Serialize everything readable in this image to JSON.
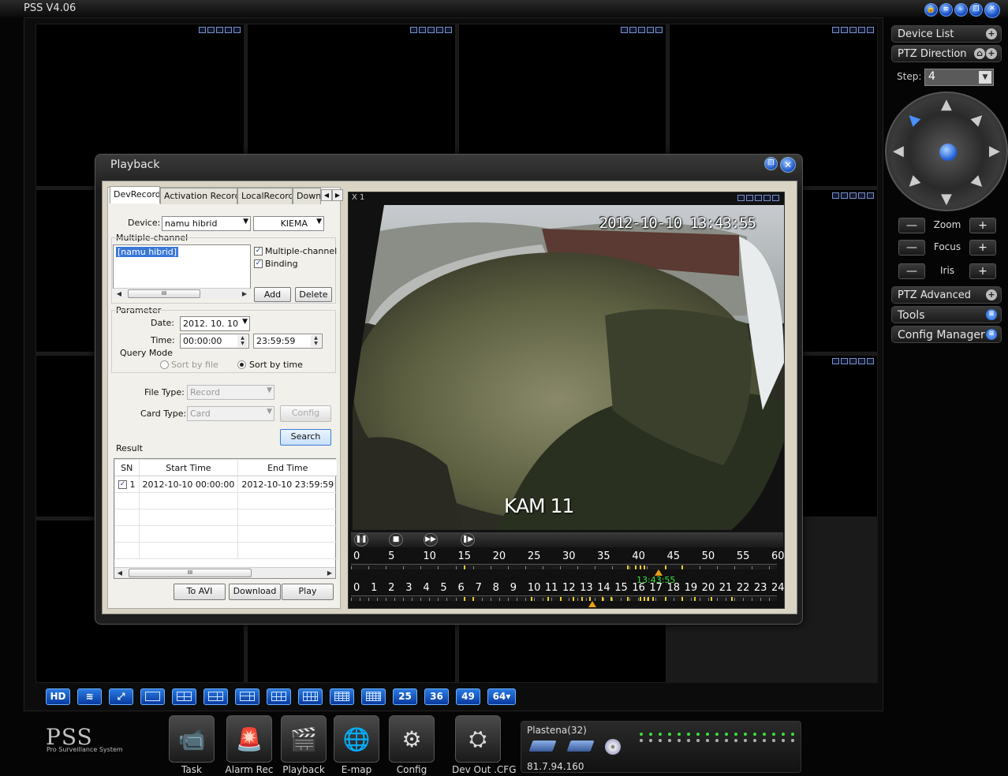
{
  "app": {
    "title": "PSS  V4.06",
    "window_buttons": [
      "lock-icon",
      "list-icon",
      "minimize-icon",
      "restore-icon",
      "close-icon"
    ]
  },
  "right_panel": {
    "device_list": "Device List",
    "ptz_direction": "PTZ Direction",
    "step_label": "Step:",
    "step_value": "4",
    "zoom": "Zoom",
    "focus": "Focus",
    "iris": "Iris",
    "minus": "—",
    "plus": "+",
    "ptz_advanced": "PTZ Advanced",
    "tools": "Tools",
    "config_manager": "Config Manager"
  },
  "layout_bar": {
    "hd": "HD",
    "n25": "25",
    "n36": "36",
    "n49": "49",
    "n64": "64▾"
  },
  "brand": {
    "name": "PSS",
    "sub": "Pro Surveillance System"
  },
  "dock": [
    {
      "label": "Task"
    },
    {
      "label": "Alarm Rec"
    },
    {
      "label": "Playback"
    },
    {
      "label": "E-map"
    },
    {
      "label": "Config"
    },
    {
      "label": "Dev Out .CFG"
    }
  ],
  "status": {
    "name": "Plastena(32)",
    "ip": "81.7.94.160"
  },
  "playback": {
    "title": "Playback",
    "tabs": [
      "DevRecord",
      "Activation Record",
      "LocalRecord",
      "Downl"
    ],
    "device_label": "Device:",
    "device_value": "namu hibrid",
    "device2_value": "KIEMA",
    "multiple_channel_group": "Multiple-channel",
    "channel_item": "[namu hibrid]",
    "chk_multiple": "Multiple-channel",
    "chk_binding": "Binding",
    "add": "Add",
    "delete": "Delete",
    "parameter": "Parameter",
    "date_label": "Date:",
    "date_value": "2012. 10. 10",
    "time_label": "Time:",
    "time_start": "00:00:00",
    "time_end": "23:59:59",
    "query_mode": "Query Mode",
    "sort_file": "Sort by file",
    "sort_time": "Sort by time",
    "file_type_label": "File Type:",
    "file_type_value": "Record",
    "card_type_label": "Card Type:",
    "card_type_value": "Card",
    "config": "Config",
    "search": "Search",
    "result": "Result",
    "result_headers": [
      "SN",
      "Start Time",
      "End Time"
    ],
    "result_rows": [
      {
        "sn": "1",
        "start": "2012-10-10 00:00:00",
        "end": "2012-10-10 23:59:59"
      }
    ],
    "to_avi": "To AVI",
    "download": "Download",
    "play": "Play",
    "player_label": "X 1",
    "video_timestamp": "2012-10-10 13:43:55",
    "video_camera": "KAM 11",
    "timeline_minutes": [
      "0",
      "5",
      "10",
      "15",
      "20",
      "25",
      "30",
      "35",
      "40",
      "45",
      "50",
      "55",
      "60"
    ],
    "timeline_hours": [
      "0",
      "1",
      "2",
      "3",
      "4",
      "5",
      "6",
      "7",
      "8",
      "9",
      "10",
      "11",
      "12",
      "13",
      "14",
      "15",
      "16",
      "17",
      "18",
      "19",
      "20",
      "21",
      "22",
      "23",
      "24"
    ],
    "timeline_cursor_time": "13:43:55"
  }
}
